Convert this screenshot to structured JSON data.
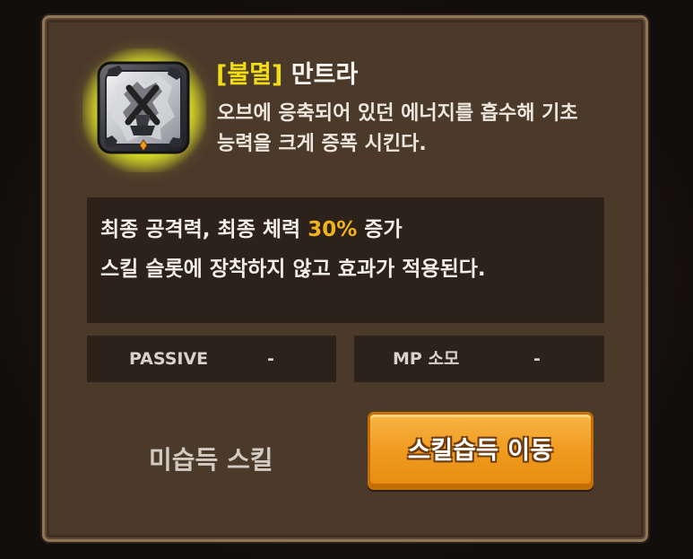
{
  "skill": {
    "tag": "[불멸]",
    "name": "만트라",
    "icon": "skill-icon",
    "description_lines": [
      "오브에 응축되어 있던 에너지를 흡수해 기초",
      "능력을 크게 증폭 시킨다."
    ]
  },
  "effect": {
    "line1_prefix": "최종 공격력, 최종 체력 ",
    "line1_value": "30%",
    "line1_suffix": " 증가",
    "line2": "스킬 슬롯에 장착하지 않고 효과가 적용된다."
  },
  "stats": {
    "passive_label": "PASSIVE",
    "passive_value": "-",
    "mp_label": "MP 소모",
    "mp_value": "-"
  },
  "status": {
    "unlearned_text": "미습득 스킬"
  },
  "actions": {
    "move_button_label": "스킬습득 이동"
  },
  "colors": {
    "tag": "#f2dd14",
    "highlight": "#f2b31c",
    "button": "#ef9a1d"
  }
}
